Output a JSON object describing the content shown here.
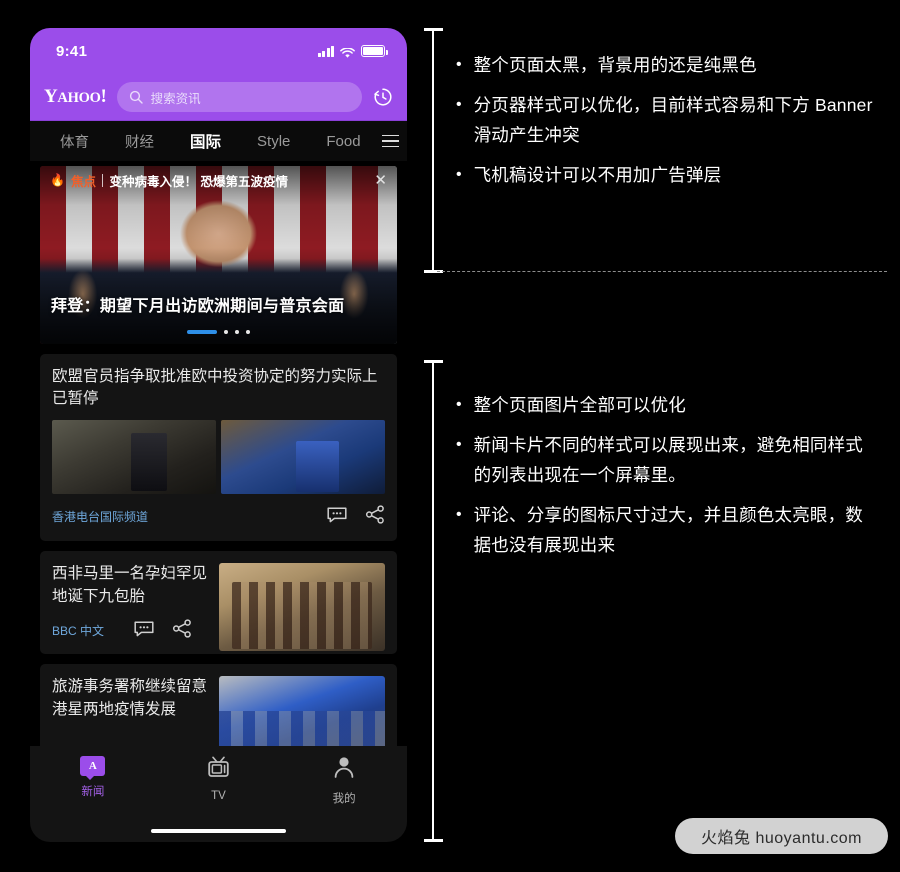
{
  "phone": {
    "status": {
      "clock": "9:41",
      "signal_icon": "signal-bars-icon",
      "wifi_icon": "wifi-icon",
      "battery_icon": "battery-icon"
    },
    "header": {
      "logo": "YAHOO!",
      "search_placeholder": "搜索资讯",
      "search_value": "",
      "search_icon": "search-icon",
      "history_icon": "history-clock-icon"
    },
    "tabs": [
      {
        "label": "体育",
        "active": false
      },
      {
        "label": "财经",
        "active": false
      },
      {
        "label": "国际",
        "active": true
      },
      {
        "label": "Style",
        "active": false
      },
      {
        "label": "Food",
        "active": false
      }
    ],
    "menu_icon": "hamburger-menu-icon",
    "carousel": {
      "focus_flame_icon": "flame-icon",
      "focus_tag": "焦点",
      "focus_text": "变种病毒入侵！ 恐爆第五波疫情",
      "close_icon": "close-icon",
      "title": "拜登：期望下月出访欧洲期间与普京会面",
      "pagination": {
        "active_index": 0,
        "total": 4
      }
    },
    "cards": [
      {
        "title": "欧盟官员指争取批准欧中投资协定的努力实际上已暂停",
        "source": "香港电台国际频道",
        "layout": "dual-image",
        "comment_icon": "comment-icon",
        "share_icon": "share-icon"
      },
      {
        "title": "西非马里一名孕妇罕见地诞下九包胎",
        "source": "BBC 中文",
        "layout": "side-thumb",
        "comment_icon": "comment-icon",
        "share_icon": "share-icon"
      },
      {
        "title": "旅游事务署称继续留意港星两地疫情发展",
        "source": "",
        "layout": "side-thumb",
        "comment_icon": "comment-icon",
        "share_icon": "share-icon"
      }
    ],
    "bottom_nav": [
      {
        "label": "新闻",
        "icon": "news-icon",
        "active": true
      },
      {
        "label": "TV",
        "icon": "tv-icon",
        "active": false
      },
      {
        "label": "我的",
        "icon": "person-icon",
        "active": false
      }
    ]
  },
  "annotations": {
    "group_one": [
      "整个页面太黑，背景用的还是纯黑色",
      "分页器样式可以优化，目前样式容易和下方 Banner 滑动产生冲突",
      "飞机稿设计可以不用加广告弹层"
    ],
    "group_two": [
      "整个页面图片全部可以优化",
      "新闻卡片不同的样式可以展现出来，避免相同样式的列表出现在一个屏幕里。",
      "评论、分享的图标尺寸过大，并且颜色太亮眼，数据也没有展现出来"
    ],
    "bullet_glyph": "•"
  },
  "watermark": {
    "text": "火焰兔 huoyantu.com"
  },
  "colors": {
    "brand_purple": "#9b4dea",
    "page_black": "#000000",
    "card_bg": "#141414",
    "source_blue": "#6fa8dc",
    "focus_orange": "#f0602a",
    "pager_blue": "#2e8fe8",
    "watermark_bg": "#d2d2d2"
  }
}
